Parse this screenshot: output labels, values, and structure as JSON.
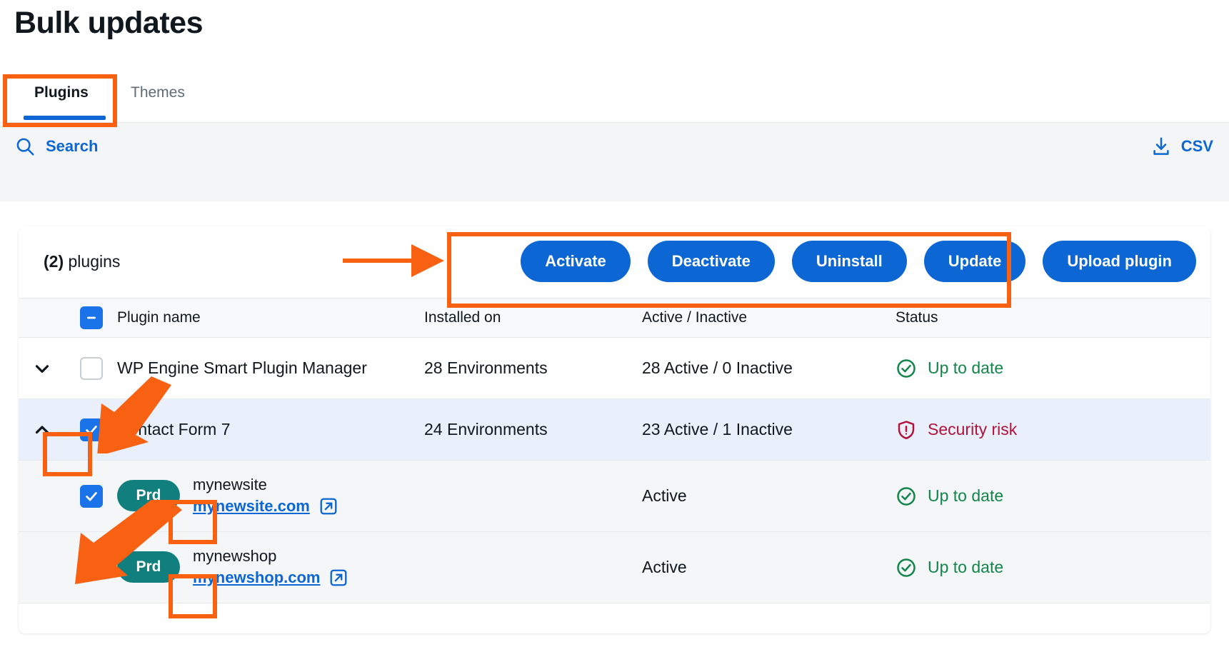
{
  "page": {
    "title": "Bulk updates"
  },
  "tabs": [
    {
      "label": "Plugins",
      "active": true
    },
    {
      "label": "Themes",
      "active": false
    }
  ],
  "toolbar": {
    "search_label": "Search",
    "search_icon": "search-icon",
    "csv_label": "CSV",
    "csv_icon": "download-icon"
  },
  "card": {
    "count_value": "(2)",
    "count_label": "plugins",
    "buttons": [
      {
        "label": "Activate"
      },
      {
        "label": "Deactivate"
      },
      {
        "label": "Uninstall"
      },
      {
        "label": "Update"
      },
      {
        "label": "Upload plugin"
      }
    ]
  },
  "table": {
    "headers": {
      "plugin_name": "Plugin name",
      "installed_on": "Installed on",
      "active_inactive": "Active / Inactive",
      "status": "Status"
    },
    "select_all_state": "indeterminate",
    "rows": [
      {
        "name": "WP Engine Smart Plugin Manager",
        "installed_on": "28 Environments",
        "active_inactive": "28 Active / 0 Inactive",
        "status": "Up to date",
        "status_kind": "ok",
        "checked": false,
        "expanded": false,
        "caret": "chevron-down-icon"
      },
      {
        "name": "Contact Form 7",
        "installed_on": "24 Environments",
        "active_inactive": "23 Active / 1 Inactive",
        "status": "Security risk",
        "status_kind": "risk",
        "checked": true,
        "expanded": true,
        "caret": "chevron-up-icon",
        "children": [
          {
            "env_badge": "Prd",
            "site_name": "mynewsite",
            "site_url": "mynewsite.com",
            "active_inactive": "Active",
            "status": "Up to date",
            "status_kind": "ok",
            "checked": true
          },
          {
            "env_badge": "Prd",
            "site_name": "mynewshop",
            "site_url": "mynewshop.com",
            "active_inactive": "Active",
            "status": "Up to date",
            "status_kind": "ok",
            "checked": true
          }
        ]
      }
    ]
  },
  "colors": {
    "accent_blue": "#0c66d3",
    "annotation_orange": "#f96112",
    "badge_teal": "#127f7f",
    "status_ok_green": "#12854a",
    "status_risk_red": "#b3123a",
    "page_bg": "#ffffff",
    "toolbar_bg": "#f3f5f7",
    "selected_row_bg": "#eaf0fb",
    "sub_row_bg": "#f4f6f8"
  }
}
